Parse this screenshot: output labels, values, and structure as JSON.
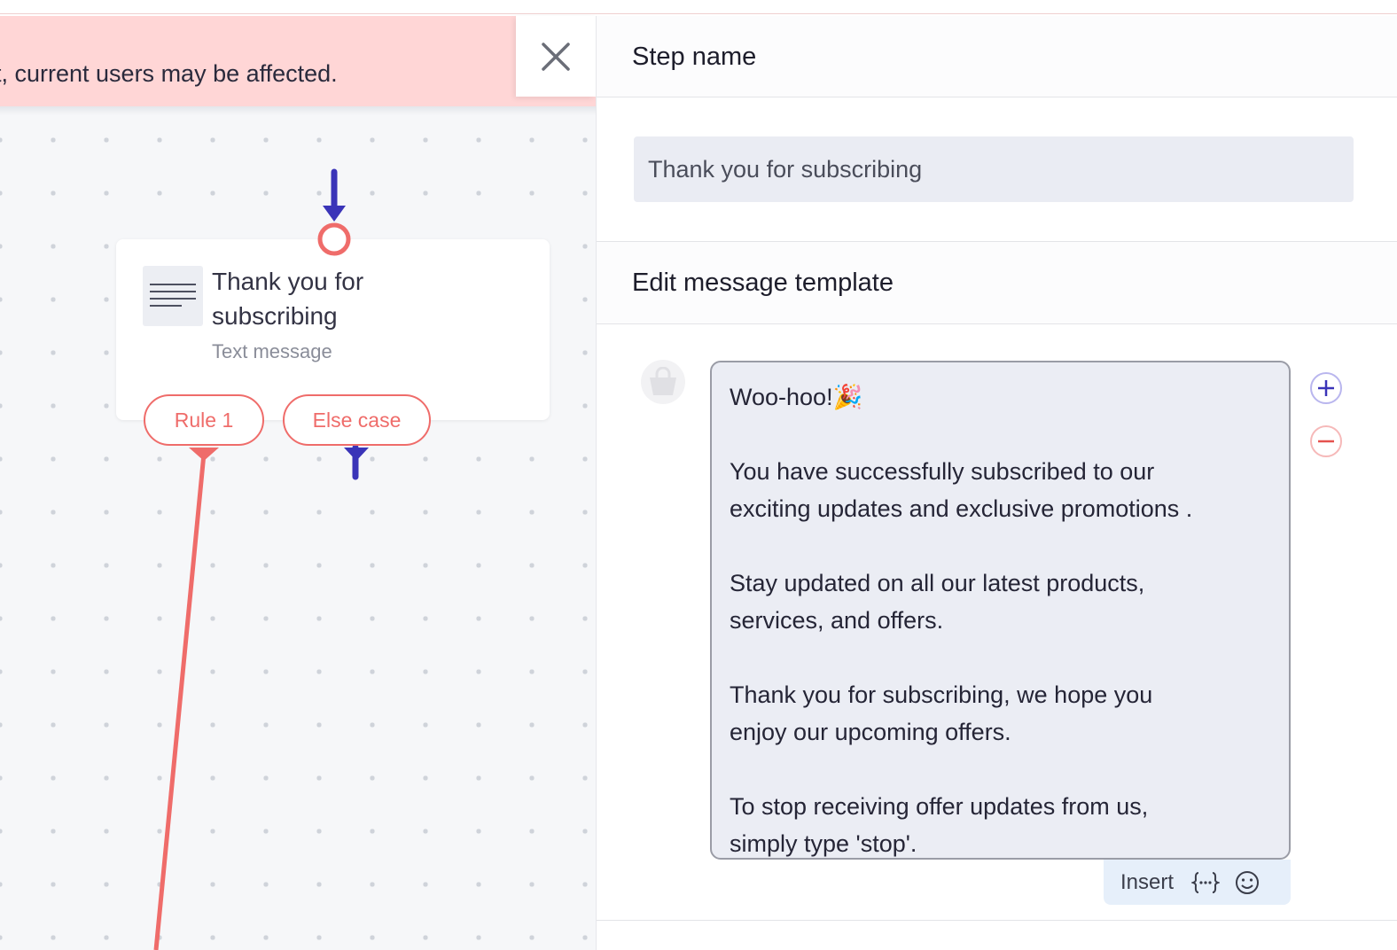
{
  "banner": {
    "message": "t, current users may be affected.",
    "close_icon": "close-icon"
  },
  "canvas": {
    "node": {
      "title": "Thank you for subscribing",
      "subtitle": "Text message",
      "icon": "text-lines-icon"
    },
    "branches": [
      {
        "label": "Rule 1"
      },
      {
        "label": "Else case"
      }
    ],
    "colors": {
      "connector_incoming": "#3a34b8",
      "connector_rule": "#ef6c6a",
      "accent": "#ef6c6a"
    }
  },
  "panel": {
    "step_name": {
      "header": "Step name",
      "value": "Thank you for subscribing"
    },
    "template": {
      "header": "Edit message template",
      "lines": [
        "Woo-hoo!🎉",
        "",
        "You have successfully subscribed to our",
        "exciting updates and exclusive promotions .",
        "",
        "Stay updated on all our latest products,",
        "services, and offers.",
        "",
        "Thank you for subscribing, we hope you",
        "enjoy our upcoming offers.",
        "",
        "To stop receiving offer updates from us,",
        "simply type 'stop'."
      ],
      "insert_label": "Insert",
      "variable_icon": "curly-braces-icon",
      "emoji_icon": "smiley-icon",
      "avatar_icon": "shopping-bag-icon",
      "add_icon": "plus-circle-icon",
      "remove_icon": "minus-circle-icon"
    }
  }
}
